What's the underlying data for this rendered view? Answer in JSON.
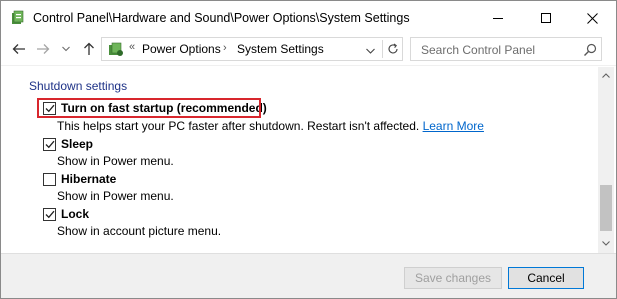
{
  "window": {
    "title": "Control Panel\\Hardware and Sound\\Power Options\\System Settings",
    "controls": {
      "minimize_icon": "minimize-icon",
      "maximize_icon": "maximize-icon",
      "close_icon": "close-icon"
    }
  },
  "navigation": {
    "back_icon": "arrow-left-icon",
    "forward_icon": "arrow-right-icon",
    "recent_icon": "chevron-down-icon",
    "up_icon": "arrow-up-icon"
  },
  "address_bar": {
    "overflow": "«",
    "breadcrumbs": [
      {
        "label": "Power Options"
      },
      {
        "label": "System Settings"
      }
    ],
    "separator": "›"
  },
  "search": {
    "placeholder": "Search Control Panel",
    "icon": "search-icon"
  },
  "content": {
    "section_title": "Shutdown settings",
    "options": [
      {
        "label": "Turn on fast startup (recommended)",
        "checked": true,
        "description": "This helps start your PC faster after shutdown. Restart isn't affected.",
        "link": "Learn More",
        "highlighted": true
      },
      {
        "label": "Sleep",
        "checked": true,
        "description": "Show in Power menu."
      },
      {
        "label": "Hibernate",
        "checked": false,
        "description": "Show in Power menu."
      },
      {
        "label": "Lock",
        "checked": true,
        "description": "Show in account picture menu."
      }
    ],
    "highlight_color": "#d8262d",
    "link_color": "#0066cc",
    "section_title_color": "#1e3287"
  },
  "footer": {
    "save_label": "Save changes",
    "save_enabled": false,
    "cancel_label": "Cancel"
  }
}
